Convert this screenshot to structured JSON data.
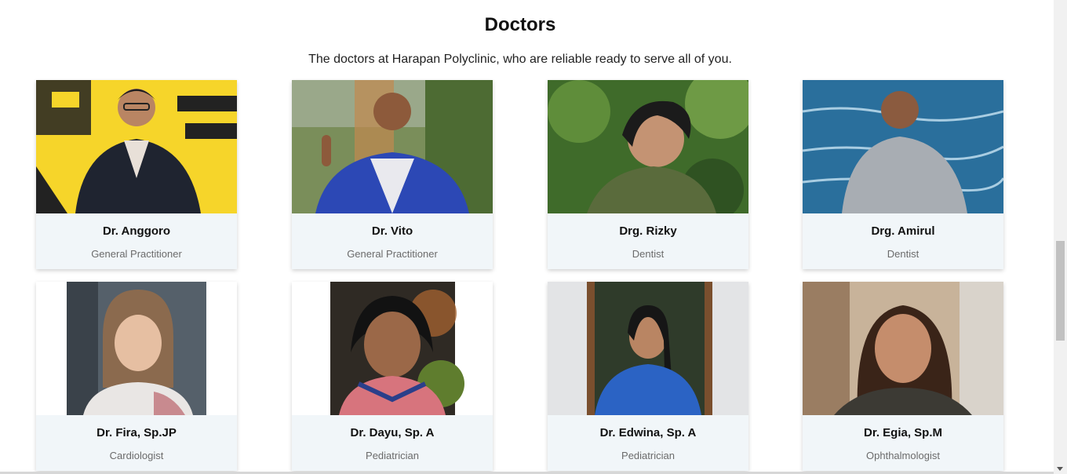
{
  "section": {
    "title": "Doctors",
    "subtitle": "The doctors at Harapan Polyclinic, who are reliable ready to serve all of you."
  },
  "doctors": [
    {
      "name": "Dr. Anggoro",
      "specialty": "General Practitioner"
    },
    {
      "name": "Dr. Vito",
      "specialty": "General Practitioner"
    },
    {
      "name": "Drg. Rizky",
      "specialty": "Dentist"
    },
    {
      "name": "Drg. Amirul",
      "specialty": "Dentist"
    },
    {
      "name": "Dr. Fira, Sp.JP",
      "specialty": "Cardiologist"
    },
    {
      "name": "Dr. Dayu, Sp. A",
      "specialty": "Pediatrician"
    },
    {
      "name": "Dr. Edwina, Sp. A",
      "specialty": "Pediatrician"
    },
    {
      "name": "Dr. Egia, Sp.M",
      "specialty": "Ophthalmologist"
    }
  ],
  "colors": {
    "card_background": "#f1f6f9",
    "specialty_text": "#6b6b6b"
  }
}
